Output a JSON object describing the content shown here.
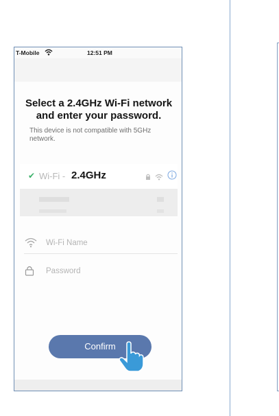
{
  "status_bar": {
    "carrier": "T-Mobile",
    "time": "12:51 PM"
  },
  "screen": {
    "title": "Select a 2.4GHz  Wi-Fi network and enter your password.",
    "subtitle": "This device is not compatible with 5GHz network.",
    "wifi_selection": {
      "prefix": "Wi-Fi - ",
      "band": "2.4GHz"
    },
    "fields": {
      "wifi_name_placeholder": "Wi-Fi Name",
      "password_placeholder": "Password"
    },
    "confirm_label": "Confirm"
  },
  "colors": {
    "accent": "#5a78ad",
    "check": "#3db26b",
    "info": "#7aa7e0",
    "frame": "#6f8fb5"
  },
  "icons": [
    "wifi-icon",
    "check-icon",
    "lock-icon",
    "info-icon",
    "password-lock-icon",
    "hand-pointer-icon"
  ]
}
